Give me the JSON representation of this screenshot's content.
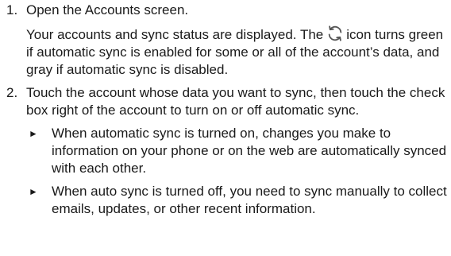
{
  "steps": [
    {
      "number": "1.",
      "title": "Open the Accounts screen.",
      "body_before_icon": "Your accounts and sync status are displayed. The",
      "icon": "sync-icon",
      "body_after_icon": "icon turns green if automatic sync is enabled for some or all of the account’s data, and gray if automatic sync is disabled."
    },
    {
      "number": "2.",
      "title": "Touch the account whose data you want to sync, then touch the check box right of the account to turn on or off automatic sync.",
      "bullets": [
        {
          "marker": "►",
          "text": "When automatic sync is turned on, changes you make to information on your phone or on the web are automatically synced with each other."
        },
        {
          "marker": "►",
          "text": "When auto sync is turned off, you need to sync manually to collect emails, updates, or other recent information."
        }
      ]
    }
  ],
  "colors": {
    "text": "#1a1a1a",
    "icon": "#555555"
  }
}
